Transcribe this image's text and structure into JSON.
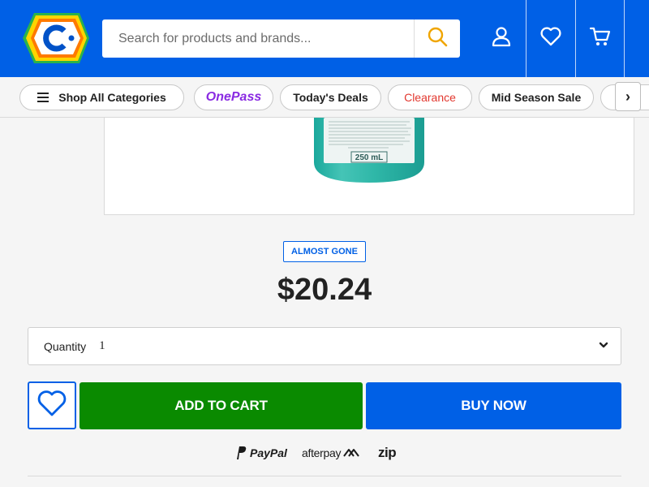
{
  "header": {
    "logo_alt": "C",
    "search_placeholder": "Search for products and brands...",
    "icons": [
      "search-icon",
      "account-icon",
      "wishlist-heart-icon",
      "cart-icon"
    ]
  },
  "nav": {
    "chips": [
      {
        "label": "Shop All Categories",
        "icon": "menu-icon"
      },
      {
        "label": "OnePass",
        "color": "#8a2be2"
      },
      {
        "label": "Today's Deals"
      },
      {
        "label": "Clearance",
        "color": "#e2372e"
      },
      {
        "label": "Mid Season Sale"
      }
    ],
    "next_symbol": "›"
  },
  "product": {
    "image_label": "250 mL",
    "stock_badge": "ALMOST GONE",
    "price": "$20.24"
  },
  "quantity": {
    "label": "Quantity",
    "value": "1"
  },
  "actions": {
    "add_to_cart": "ADD TO CART",
    "buy_now": "BUY NOW"
  },
  "payments": {
    "paypal": "PayPal",
    "afterpay": "afterpay",
    "zip": "zip"
  },
  "colors": {
    "brand_blue": "#0060e6",
    "add_to_cart_green": "#0a8a00",
    "logo_yellow": "#ffd400",
    "logo_green": "#2bb34a",
    "logo_orange": "#ff7a00"
  }
}
